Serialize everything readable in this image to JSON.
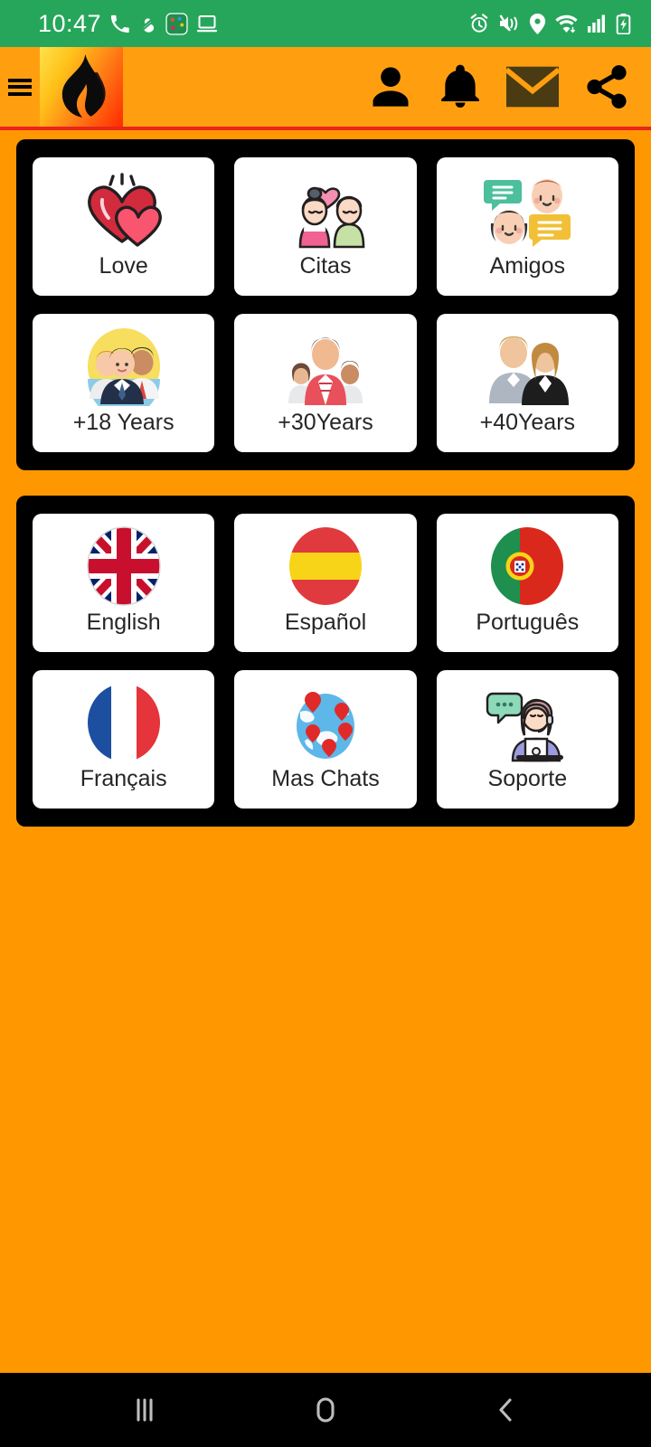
{
  "status_bar": {
    "clock": "10:47",
    "background": "#26A65B",
    "left_icons": [
      "phone-call-icon",
      "do-not-disturb-icon",
      "green-app-icon",
      "screen-cast-icon"
    ],
    "right_icons": [
      "alarm-icon",
      "mute-vibrate-icon",
      "location-icon",
      "wifi-icon",
      "signal-bars-icon",
      "battery-charging-icon"
    ]
  },
  "app_bar": {
    "background": "#FF9F10",
    "underline_color": "#E8241C",
    "menu_label": "menu",
    "logo_label": "flame-logo",
    "actions": [
      {
        "name": "profile-button",
        "icon": "person-icon",
        "color": "#000000"
      },
      {
        "name": "notifications-button",
        "icon": "bell-icon",
        "color": "#000000"
      },
      {
        "name": "messages-button",
        "icon": "envelope-icon",
        "color": "#4A3B12"
      },
      {
        "name": "share-button",
        "icon": "share-icon",
        "color": "#000000"
      }
    ]
  },
  "panels": [
    {
      "name": "categories-panel",
      "tiles": [
        {
          "label": "Love",
          "icon": "two-hearts-icon"
        },
        {
          "label": "Citas",
          "icon": "couple-with-heart-icon"
        },
        {
          "label": "Amigos",
          "icon": "friends-chat-icon"
        },
        {
          "label": "+18 Years",
          "icon": "young-people-group-icon"
        },
        {
          "label": "+30Years",
          "icon": "family-group-icon"
        },
        {
          "label": "+40Years",
          "icon": "mature-couple-icon"
        }
      ]
    },
    {
      "name": "languages-panel",
      "tiles": [
        {
          "label": "English",
          "icon": "flag-uk-icon"
        },
        {
          "label": "Español",
          "icon": "flag-spain-icon"
        },
        {
          "label": "Português",
          "icon": "flag-portugal-icon"
        },
        {
          "label": "Français",
          "icon": "flag-france-icon"
        },
        {
          "label": "Mas Chats",
          "icon": "globe-pins-icon"
        },
        {
          "label": "Soporte",
          "icon": "support-agent-icon"
        }
      ]
    }
  ],
  "nav_bar": {
    "background": "#000000",
    "buttons": [
      {
        "name": "recents-button",
        "icon": "recents-icon"
      },
      {
        "name": "home-button",
        "icon": "home-circle-icon"
      },
      {
        "name": "back-button",
        "icon": "back-chevron-icon"
      }
    ]
  },
  "theme": {
    "background": "#FF9800",
    "panel": "#000000",
    "tile": "#FFFFFF",
    "text": "#262626"
  }
}
